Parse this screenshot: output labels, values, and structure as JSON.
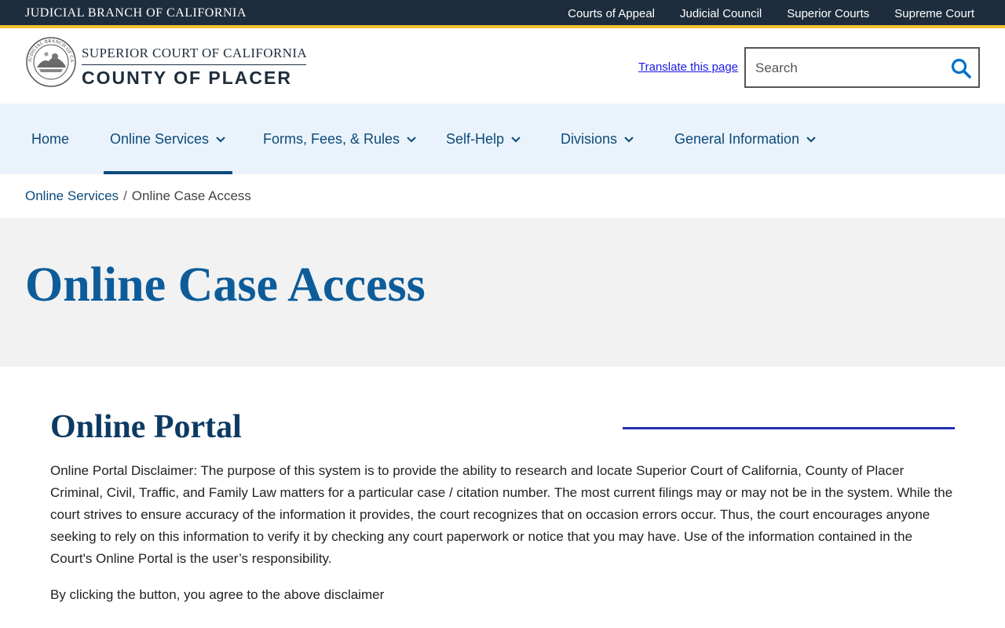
{
  "topbar": {
    "brand": "JUDICIAL BRANCH OF CALIFORNIA",
    "links": [
      "Courts of Appeal",
      "Judicial Council",
      "Superior Courts",
      "Supreme Court"
    ]
  },
  "header": {
    "logo_line1": "SUPERIOR COURT OF CALIFORNIA",
    "logo_line2": "COUNTY OF PLACER",
    "seal_text": "JUDICIAL BRANCH OF CALIFORNIA",
    "translate_link": "Translate this page",
    "search": {
      "placeholder": "Search",
      "value": ""
    }
  },
  "nav": {
    "items": [
      {
        "label": "Home"
      },
      {
        "label": "Online Services"
      },
      {
        "label": "Forms, Fees, & Rules"
      },
      {
        "label": "Self-Help"
      },
      {
        "label": "Divisions"
      },
      {
        "label": "General Information"
      }
    ]
  },
  "breadcrumb": {
    "parent": "Online Services",
    "separator": "/",
    "current": "Online Case Access"
  },
  "page": {
    "title": "Online Case Access",
    "section_heading": "Online Portal",
    "disclaimer": "Online Portal Disclaimer: The purpose of this system is to provide the ability to research and locate Superior Court of California, County of Placer Criminal, Civil, Traffic, and Family Law matters for a particular case / citation number. The most current filings may or may not be in the system. While the court strives to ensure accuracy of the information it provides, the court recognizes that on occasion errors occur. Thus, the court encourages anyone seeking to rely on this information to verify it by checking any court paperwork or notice that you may have. Use of the information contained in the Court's Online Portal is the user’s responsibility.",
    "agree_text": "By clicking the button, you agree to the above disclaimer"
  },
  "colors": {
    "topbar_bg": "#1e2d3d",
    "accent_gold": "#f2c12e",
    "nav_bg": "#eaf3fb",
    "brand_blue": "#0d4a7a",
    "title_blue": "#0d5c9a",
    "rule_blue": "#2330b8"
  }
}
